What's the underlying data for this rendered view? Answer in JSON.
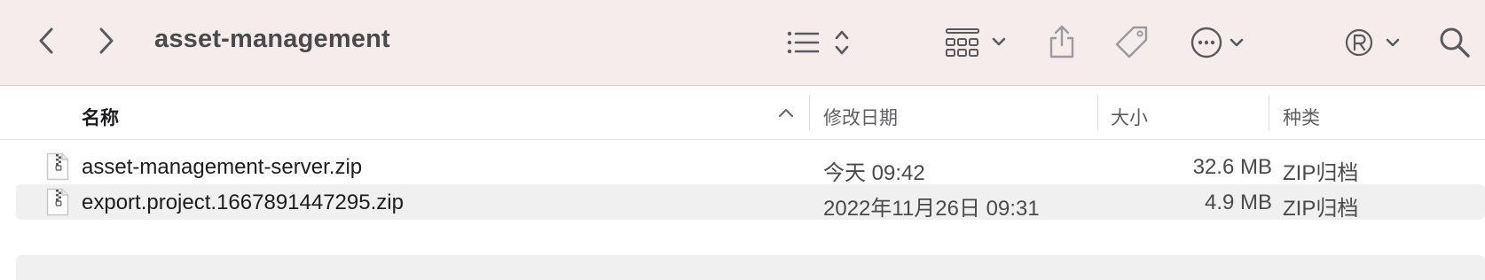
{
  "window": {
    "title": "asset-management"
  },
  "toolbar": {
    "back_icon": "chevron-left",
    "forward_icon": "chevron-right",
    "list_view_icon": "list",
    "group_icon": "grid-group",
    "share_icon": "share",
    "tag_icon": "tag",
    "action_icon": "ellipsis-circle",
    "registered_icon": "registered-r",
    "search_icon": "magnifying-glass"
  },
  "columns": {
    "name": "名称",
    "date": "修改日期",
    "size": "大小",
    "kind": "种类"
  },
  "files": [
    {
      "name": "asset-management-server.zip",
      "date": "今天 09:42",
      "size": "32.6 MB",
      "kind": "ZIP归档"
    },
    {
      "name": "export.project.1667891447295.zip",
      "date": "2022年11月26日 09:31",
      "size": "4.9 MB",
      "kind": "ZIP归档"
    }
  ],
  "colors": {
    "toolbar_bg": "#f6eceb",
    "alt_row": "#f0f0f1",
    "icon": "#5a5a5e"
  }
}
